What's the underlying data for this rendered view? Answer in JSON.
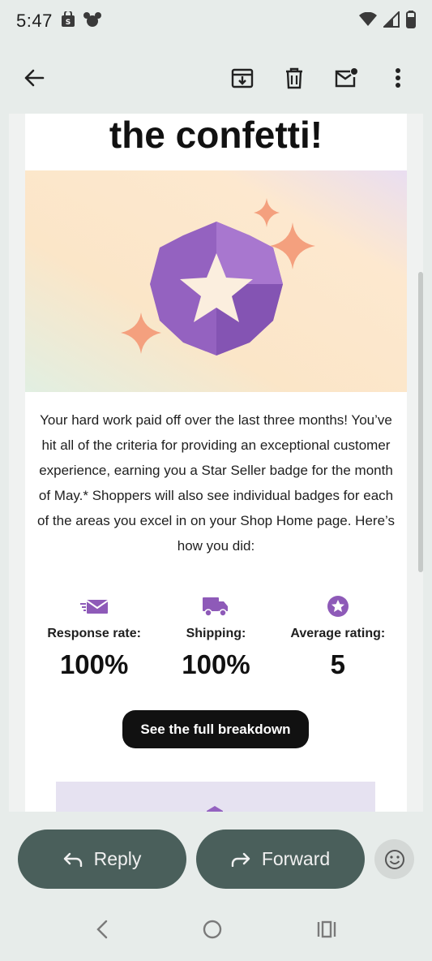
{
  "status_bar": {
    "time": "5:47",
    "left_icons": [
      "shopping-bag-icon",
      "mouse-ears-icon"
    ],
    "right_icons": [
      "wifi-icon",
      "signal-icon",
      "battery-icon"
    ]
  },
  "toolbar": {
    "back_icon": "arrow-left-icon",
    "actions": [
      "archive-icon",
      "delete-icon",
      "mark-unread-icon",
      "more-vert-icon"
    ]
  },
  "email": {
    "headline": "the confetti!",
    "body": "Your hard work paid off over the last three months! You’ve hit all of the criteria for providing an exceptional customer experience, earning you a Star Seller badge for the month of May.* Shoppers will also see individual badges for each of the areas you excel in on your Shop Home page. Here’s how you did:",
    "stats": [
      {
        "label": "Response rate:",
        "value": "100%",
        "icon": "mail-fast-icon"
      },
      {
        "label": "Shipping:",
        "value": "100%",
        "icon": "truck-icon"
      },
      {
        "label": "Average rating:",
        "value": "5",
        "icon": "star-circle-icon"
      }
    ],
    "cta_label": "See the full breakdown",
    "colors": {
      "accent_purple": "#8e5ab8",
      "sparkle": "#f4a07e",
      "hero_bg_start": "#fbeac8",
      "hero_bg_end": "#e8def0"
    }
  },
  "actions": {
    "reply_label": "Reply",
    "forward_label": "Forward",
    "emoji_icon": "emoji-smile-icon",
    "pill_color": "#4a5f5b"
  },
  "nav_bar": {
    "icons": [
      "back-triangle-icon",
      "home-circle-icon",
      "recents-icon"
    ]
  }
}
